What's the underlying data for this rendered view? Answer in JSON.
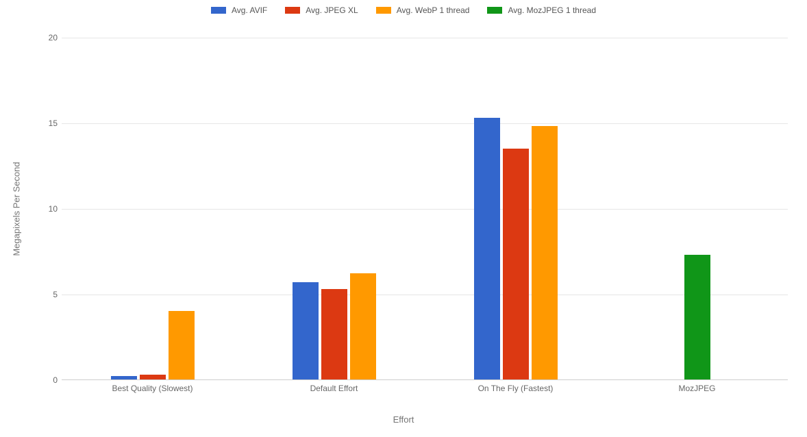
{
  "chart_data": {
    "type": "bar",
    "title": "",
    "xlabel": "Effort",
    "ylabel": "Megapixels Per Second",
    "ylim": [
      0,
      20
    ],
    "yticks": [
      0,
      5,
      10,
      15,
      20
    ],
    "categories": [
      "Best Quality (Slowest)",
      "Default Effort",
      "On The Fly (Fastest)",
      "MozJPEG"
    ],
    "series": [
      {
        "name": "Avg. AVIF",
        "color": "#3366cc",
        "values": [
          0.2,
          5.7,
          15.3,
          null
        ]
      },
      {
        "name": "Avg. JPEG XL",
        "color": "#dc3912",
        "values": [
          0.3,
          5.3,
          13.5,
          null
        ]
      },
      {
        "name": "Avg. WebP 1 thread",
        "color": "#ff9900",
        "values": [
          4.0,
          6.2,
          14.8,
          null
        ]
      },
      {
        "name": "Avg. MozJPEG 1 thread",
        "color": "#109618",
        "values": [
          null,
          null,
          null,
          7.3
        ]
      }
    ]
  }
}
